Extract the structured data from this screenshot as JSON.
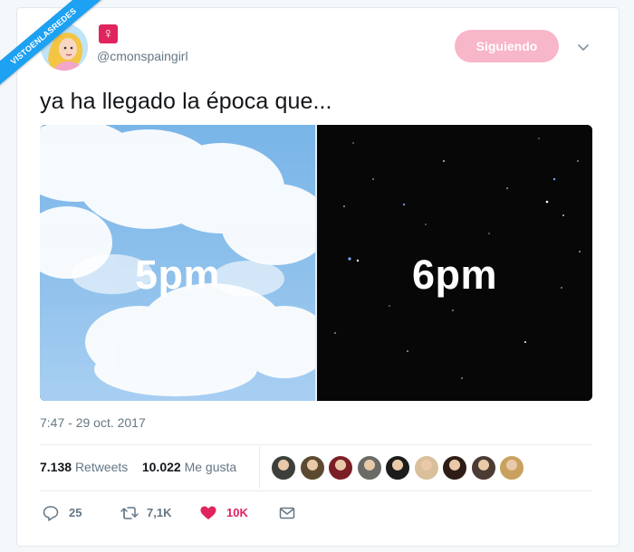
{
  "watermark": {
    "text": "VISTOENLASREDES"
  },
  "author": {
    "handle": "@cmonspaingirl",
    "badge_glyph": "♀",
    "avatar_icon": "avatar-cartoon-princess"
  },
  "follow_button": {
    "label": "Siguiendo"
  },
  "tweet": {
    "text": "ya ha llegado la época que..."
  },
  "media": {
    "left_label": "5pm",
    "right_label": "6pm"
  },
  "timestamp": "7:47 - 29 oct. 2017",
  "stats": {
    "retweets_count": "7.138",
    "retweets_label": "Retweets",
    "likes_count": "10.022",
    "likes_label": "Me gusta"
  },
  "liker_avatar_colors": [
    "#3c3f3a",
    "#5b4a2f",
    "#7a1f25",
    "#6a6a66",
    "#1c1c1c",
    "#d9c09a",
    "#2e1d16",
    "#4a3b33",
    "#c9a15f"
  ],
  "actions": {
    "reply_count": "25",
    "retweet_count": "7,1K",
    "like_count": "10K"
  },
  "colors": {
    "accent_blue": "#1da1f2",
    "like_red": "#e0245e",
    "follow_pink": "#f8b6c9",
    "muted_text": "#657786"
  }
}
